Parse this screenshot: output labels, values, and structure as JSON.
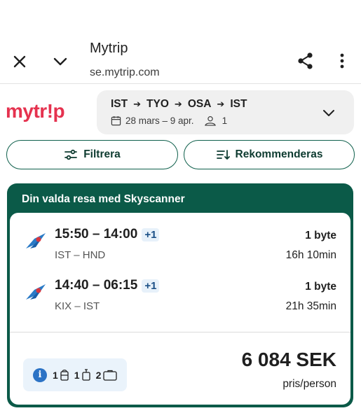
{
  "toolbar": {
    "title": "Mytrip",
    "url": "se.mytrip.com",
    "icons": [
      "close-icon",
      "chevron-down-icon",
      "share-icon",
      "more-vertical-icon"
    ]
  },
  "header": {
    "logo_text": "mytr!p",
    "route": [
      "IST",
      "TYO",
      "OSA",
      "IST"
    ],
    "route_arrow": "➔",
    "dates": "28 mars – 9 apr.",
    "travelers": "1"
  },
  "controls": {
    "filter_label": "Filtrera",
    "sort_label": "Rekommenderas"
  },
  "result": {
    "banner": "Din valda resa med Skyscanner",
    "legs": [
      {
        "times": "15:50 – 14:00",
        "day_offset": "+1",
        "airports": "IST – HND",
        "stops": "1 byte",
        "duration": "16h 10min"
      },
      {
        "times": "14:40 – 06:15",
        "day_offset": "+1",
        "airports": "KIX – IST",
        "stops": "1 byte",
        "duration": "21h 35min"
      }
    ],
    "baggage": {
      "info": "i",
      "personal_item": "1",
      "cabin_bag": "1",
      "checked_bag": "2"
    },
    "price": "6 084 SEK",
    "price_unit": "pris/person"
  },
  "colors": {
    "brand_red": "#e5324f",
    "accent_green": "#0b5a48",
    "info_blue": "#2c73c5",
    "chip_blue": "#eaf3fb"
  }
}
